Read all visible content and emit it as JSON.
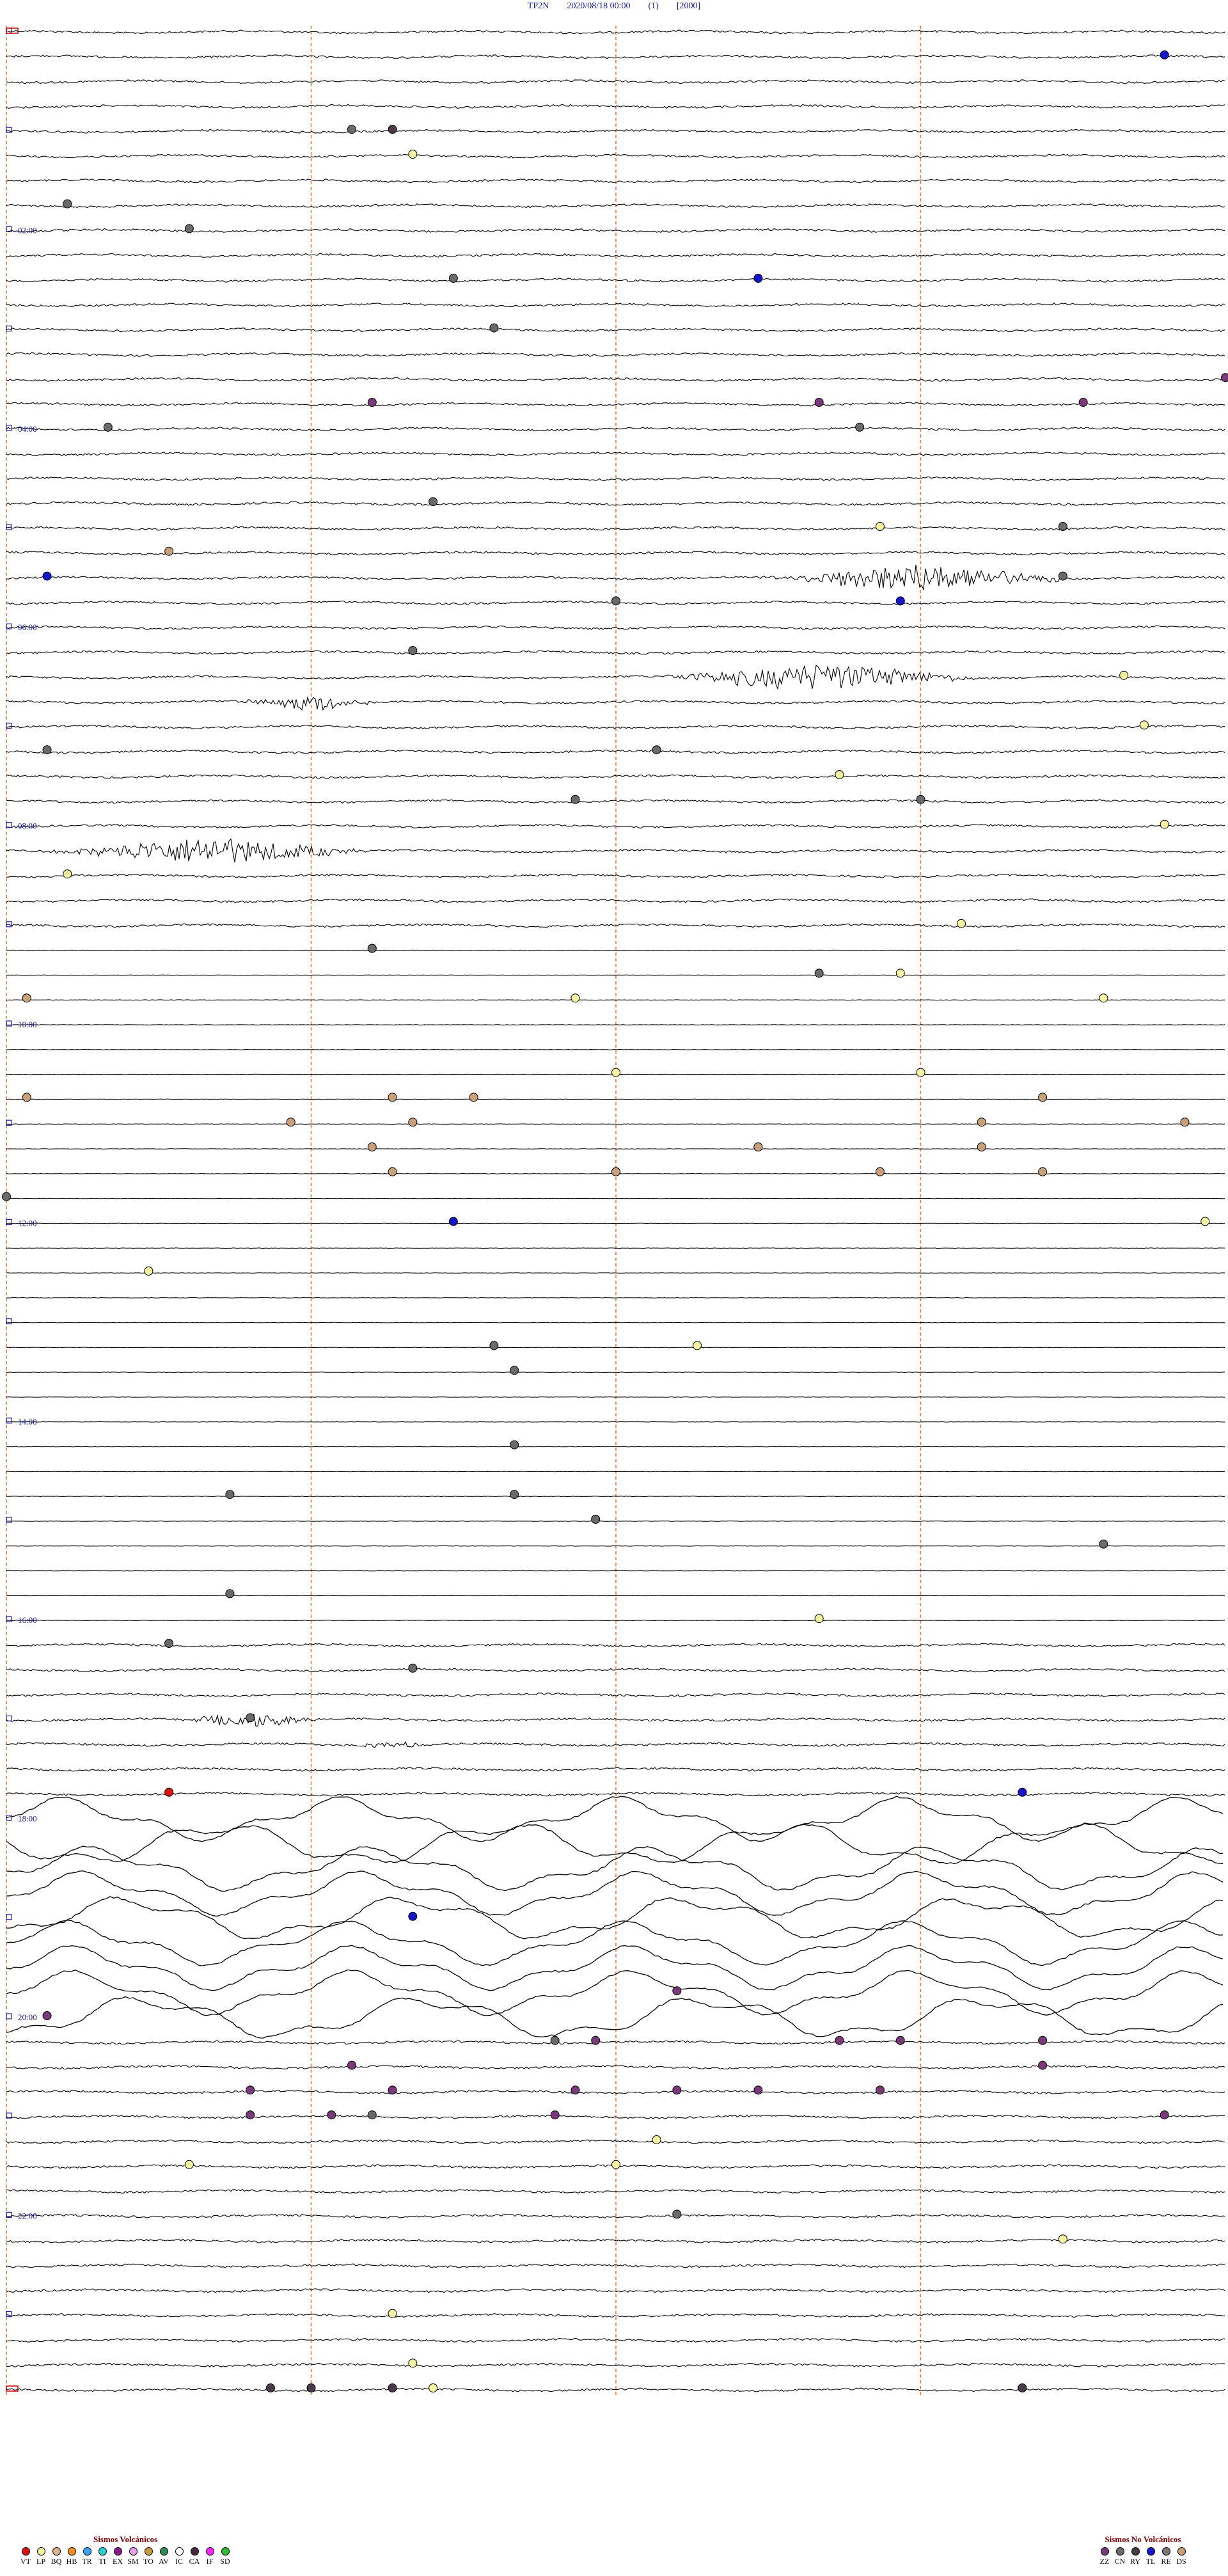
{
  "header": {
    "station": "TP2N",
    "datetime": "2020/08/18 00:00",
    "channel": "(1)",
    "scale": "[2000]"
  },
  "hour_labels": [
    "02:00",
    "04:00",
    "06:00",
    "08:00",
    "10:00",
    "12:00",
    "14:00",
    "16:00",
    "18:00",
    "20:00",
    "22:00"
  ],
  "legend_volcanic": {
    "title": "Sismos Volcánicos",
    "items": [
      {
        "code": "VT",
        "color": "#e01010"
      },
      {
        "code": "LP",
        "color": "#f2f2a0"
      },
      {
        "code": "BQ",
        "color": "#d9b68c"
      },
      {
        "code": "HB",
        "color": "#ff8c1a"
      },
      {
        "code": "TR",
        "color": "#35a6ff"
      },
      {
        "code": "TI",
        "color": "#22d4d4"
      },
      {
        "code": "EX",
        "color": "#8a1a8a"
      },
      {
        "code": "SM",
        "color": "#e8a0e8"
      },
      {
        "code": "TO",
        "color": "#c89a3a"
      },
      {
        "code": "AV",
        "color": "#2e8b57"
      },
      {
        "code": "IC",
        "color": "#ffffff"
      },
      {
        "code": "CA",
        "color": "#4a2a3a"
      },
      {
        "code": "IF",
        "color": "#ff22ff"
      },
      {
        "code": "SD",
        "color": "#33bb33"
      }
    ]
  },
  "legend_nonvolcanic": {
    "title": "Sismos No Volcánicos",
    "items": [
      {
        "code": "ZZ",
        "color": "#7a3a7a"
      },
      {
        "code": "CN",
        "color": "#6a6a6a"
      },
      {
        "code": "RY",
        "color": "#4a3a4a"
      },
      {
        "code": "TL",
        "color": "#1515cc"
      },
      {
        "code": "RE",
        "color": "#777777"
      },
      {
        "code": "DS",
        "color": "#c8a07a"
      }
    ]
  },
  "chart_data": {
    "type": "helicorder",
    "station": "TP2N",
    "start": "2020/08/18 00:00",
    "traces": 96,
    "minutes_per_trace": 15,
    "minutes_per_line": 60,
    "time_marks_minutes": [
      0,
      15,
      30,
      45,
      60
    ],
    "grid_color": "#e05a1a",
    "trace_color": "#000000",
    "label_color": "#1a1aa6",
    "activity_bands": [
      {
        "from_trace": 0,
        "to_trace": 36,
        "amplitude": "normal"
      },
      {
        "from_trace": 37,
        "to_trace": 64,
        "amplitude": "flat"
      },
      {
        "from_trace": 65,
        "to_trace": 71,
        "amplitude": "normal"
      },
      {
        "from_trace": 72,
        "to_trace": 80,
        "amplitude": "high"
      },
      {
        "from_trace": 81,
        "to_trace": 96,
        "amplitude": "normal"
      }
    ],
    "bursts": [
      {
        "trace": 22,
        "minute": 45,
        "amp": "high"
      },
      {
        "trace": 26,
        "minute": 40,
        "amp": "high"
      },
      {
        "trace": 27,
        "minute": 15,
        "amp": "medium"
      },
      {
        "trace": 33,
        "minute": 10,
        "amp": "high"
      },
      {
        "trace": 68,
        "minute": 12,
        "amp": "medium"
      },
      {
        "trace": 69,
        "minute": 19,
        "amp": "low"
      }
    ],
    "events": [
      {
        "trace": 1,
        "minute": 57,
        "type": "TL"
      },
      {
        "trace": 4,
        "minute": 17,
        "type": "CN"
      },
      {
        "trace": 4,
        "minute": 19,
        "type": "RY"
      },
      {
        "trace": 5,
        "minute": 20,
        "type": "LP"
      },
      {
        "trace": 7,
        "minute": 3,
        "type": "CN"
      },
      {
        "trace": 8,
        "minute": 9,
        "type": "CN"
      },
      {
        "trace": 10,
        "minute": 37,
        "type": "TL"
      },
      {
        "trace": 10,
        "minute": 22,
        "type": "CN"
      },
      {
        "trace": 12,
        "minute": 24,
        "type": "CN"
      },
      {
        "trace": 14,
        "minute": 60,
        "type": "ZZ"
      },
      {
        "trace": 15,
        "minute": 18,
        "type": "ZZ"
      },
      {
        "trace": 15,
        "minute": 40,
        "type": "ZZ"
      },
      {
        "trace": 15,
        "minute": 53,
        "type": "ZZ"
      },
      {
        "trace": 16,
        "minute": 42,
        "type": "CN"
      },
      {
        "trace": 16,
        "minute": 5,
        "type": "CN"
      },
      {
        "trace": 19,
        "minute": 21,
        "type": "CN"
      },
      {
        "trace": 20,
        "minute": 43,
        "type": "LP"
      },
      {
        "trace": 20,
        "minute": 52,
        "type": "CN"
      },
      {
        "trace": 21,
        "minute": 8,
        "type": "DS"
      },
      {
        "trace": 22,
        "minute": 2,
        "type": "TL"
      },
      {
        "trace": 22,
        "minute": 52,
        "type": "CN"
      },
      {
        "trace": 23,
        "minute": 30,
        "type": "CN"
      },
      {
        "trace": 23,
        "minute": 44,
        "type": "TL"
      },
      {
        "trace": 25,
        "minute": 20,
        "type": "CN"
      },
      {
        "trace": 26,
        "minute": 55,
        "type": "LP"
      },
      {
        "trace": 28,
        "minute": 56,
        "type": "LP"
      },
      {
        "trace": 29,
        "minute": 2,
        "type": "CN"
      },
      {
        "trace": 29,
        "minute": 32,
        "type": "CN"
      },
      {
        "trace": 30,
        "minute": 41,
        "type": "LP"
      },
      {
        "trace": 31,
        "minute": 28,
        "type": "CN"
      },
      {
        "trace": 31,
        "minute": 45,
        "type": "CN"
      },
      {
        "trace": 32,
        "minute": 57,
        "type": "LP"
      },
      {
        "trace": 34,
        "minute": 3,
        "type": "LP"
      },
      {
        "trace": 36,
        "minute": 47,
        "type": "LP"
      },
      {
        "trace": 37,
        "minute": 18,
        "type": "LP"
      },
      {
        "trace": 37,
        "minute": 18,
        "type": "CN"
      },
      {
        "trace": 38,
        "minute": 40,
        "type": "CN"
      },
      {
        "trace": 38,
        "minute": 44,
        "type": "LP"
      },
      {
        "trace": 39,
        "minute": 1,
        "type": "DS"
      },
      {
        "trace": 39,
        "minute": 28,
        "type": "LP"
      },
      {
        "trace": 39,
        "minute": 54,
        "type": "LP"
      },
      {
        "trace": 42,
        "minute": 30,
        "type": "LP"
      },
      {
        "trace": 42,
        "minute": 45,
        "type": "LP"
      },
      {
        "trace": 43,
        "minute": 1,
        "type": "DS"
      },
      {
        "trace": 43,
        "minute": 19,
        "type": "DS"
      },
      {
        "trace": 43,
        "minute": 23,
        "type": "DS"
      },
      {
        "trace": 43,
        "minute": 51,
        "type": "DS"
      },
      {
        "trace": 44,
        "minute": 14,
        "type": "DS"
      },
      {
        "trace": 44,
        "minute": 20,
        "type": "DS"
      },
      {
        "trace": 44,
        "minute": 48,
        "type": "DS"
      },
      {
        "trace": 44,
        "minute": 58,
        "type": "DS"
      },
      {
        "trace": 45,
        "minute": 18,
        "type": "DS"
      },
      {
        "trace": 45,
        "minute": 37,
        "type": "DS"
      },
      {
        "trace": 45,
        "minute": 48,
        "type": "DS"
      },
      {
        "trace": 46,
        "minute": 19,
        "type": "DS"
      },
      {
        "trace": 46,
        "minute": 30,
        "type": "DS"
      },
      {
        "trace": 46,
        "minute": 43,
        "type": "DS"
      },
      {
        "trace": 46,
        "minute": 51,
        "type": "DS"
      },
      {
        "trace": 47,
        "minute": 0,
        "type": "CN"
      },
      {
        "trace": 48,
        "minute": 22,
        "type": "TL"
      },
      {
        "trace": 48,
        "minute": 59,
        "type": "LP"
      },
      {
        "trace": 50,
        "minute": 7,
        "type": "LP"
      },
      {
        "trace": 53,
        "minute": 34,
        "type": "LP"
      },
      {
        "trace": 53,
        "minute": 24,
        "type": "CN"
      },
      {
        "trace": 54,
        "minute": 25,
        "type": "CN"
      },
      {
        "trace": 57,
        "minute": 25,
        "type": "CN"
      },
      {
        "trace": 59,
        "minute": 11,
        "type": "CN"
      },
      {
        "trace": 59,
        "minute": 25,
        "type": "CN"
      },
      {
        "trace": 60,
        "minute": 29,
        "type": "CN"
      },
      {
        "trace": 61,
        "minute": 54,
        "type": "CN"
      },
      {
        "trace": 63,
        "minute": 11,
        "type": "CN"
      },
      {
        "trace": 64,
        "minute": 40,
        "type": "LP"
      },
      {
        "trace": 65,
        "minute": 8,
        "type": "CN"
      },
      {
        "trace": 66,
        "minute": 20,
        "type": "CN"
      },
      {
        "trace": 68,
        "minute": 12,
        "type": "CN"
      },
      {
        "trace": 71,
        "minute": 8,
        "type": "VT"
      },
      {
        "trace": 71,
        "minute": 50,
        "type": "TL"
      },
      {
        "trace": 76,
        "minute": 20,
        "type": "TL"
      },
      {
        "trace": 79,
        "minute": 33,
        "type": "ZZ"
      },
      {
        "trace": 80,
        "minute": 2,
        "type": "ZZ"
      },
      {
        "trace": 81,
        "minute": 27,
        "type": "CN"
      },
      {
        "trace": 81,
        "minute": 29,
        "type": "ZZ"
      },
      {
        "trace": 81,
        "minute": 41,
        "type": "ZZ"
      },
      {
        "trace": 81,
        "minute": 44,
        "type": "ZZ"
      },
      {
        "trace": 81,
        "minute": 51,
        "type": "ZZ"
      },
      {
        "trace": 82,
        "minute": 17,
        "type": "ZZ"
      },
      {
        "trace": 82,
        "minute": 51,
        "type": "ZZ"
      },
      {
        "trace": 83,
        "minute": 12,
        "type": "ZZ"
      },
      {
        "trace": 83,
        "minute": 19,
        "type": "ZZ"
      },
      {
        "trace": 83,
        "minute": 28,
        "type": "ZZ"
      },
      {
        "trace": 83,
        "minute": 33,
        "type": "ZZ"
      },
      {
        "trace": 83,
        "minute": 37,
        "type": "ZZ"
      },
      {
        "trace": 83,
        "minute": 43,
        "type": "ZZ"
      },
      {
        "trace": 84,
        "minute": 12,
        "type": "ZZ"
      },
      {
        "trace": 84,
        "minute": 16,
        "type": "ZZ"
      },
      {
        "trace": 84,
        "minute": 27,
        "type": "ZZ"
      },
      {
        "trace": 84,
        "minute": 57,
        "type": "ZZ"
      },
      {
        "trace": 84,
        "minute": 18,
        "type": "CN"
      },
      {
        "trace": 85,
        "minute": 32,
        "type": "LP"
      },
      {
        "trace": 86,
        "minute": 9,
        "type": "LP"
      },
      {
        "trace": 86,
        "minute": 30,
        "type": "LP"
      },
      {
        "trace": 88,
        "minute": 33,
        "type": "CN"
      },
      {
        "trace": 89,
        "minute": 52,
        "type": "LP"
      },
      {
        "trace": 92,
        "minute": 19,
        "type": "LP"
      },
      {
        "trace": 94,
        "minute": 20,
        "type": "LP"
      },
      {
        "trace": 95,
        "minute": 13,
        "type": "RY"
      },
      {
        "trace": 95,
        "minute": 15,
        "type": "RY"
      },
      {
        "trace": 95,
        "minute": 19,
        "type": "RY"
      },
      {
        "trace": 95,
        "minute": 21,
        "type": "LP"
      },
      {
        "trace": 95,
        "minute": 50,
        "type": "RY"
      }
    ]
  }
}
